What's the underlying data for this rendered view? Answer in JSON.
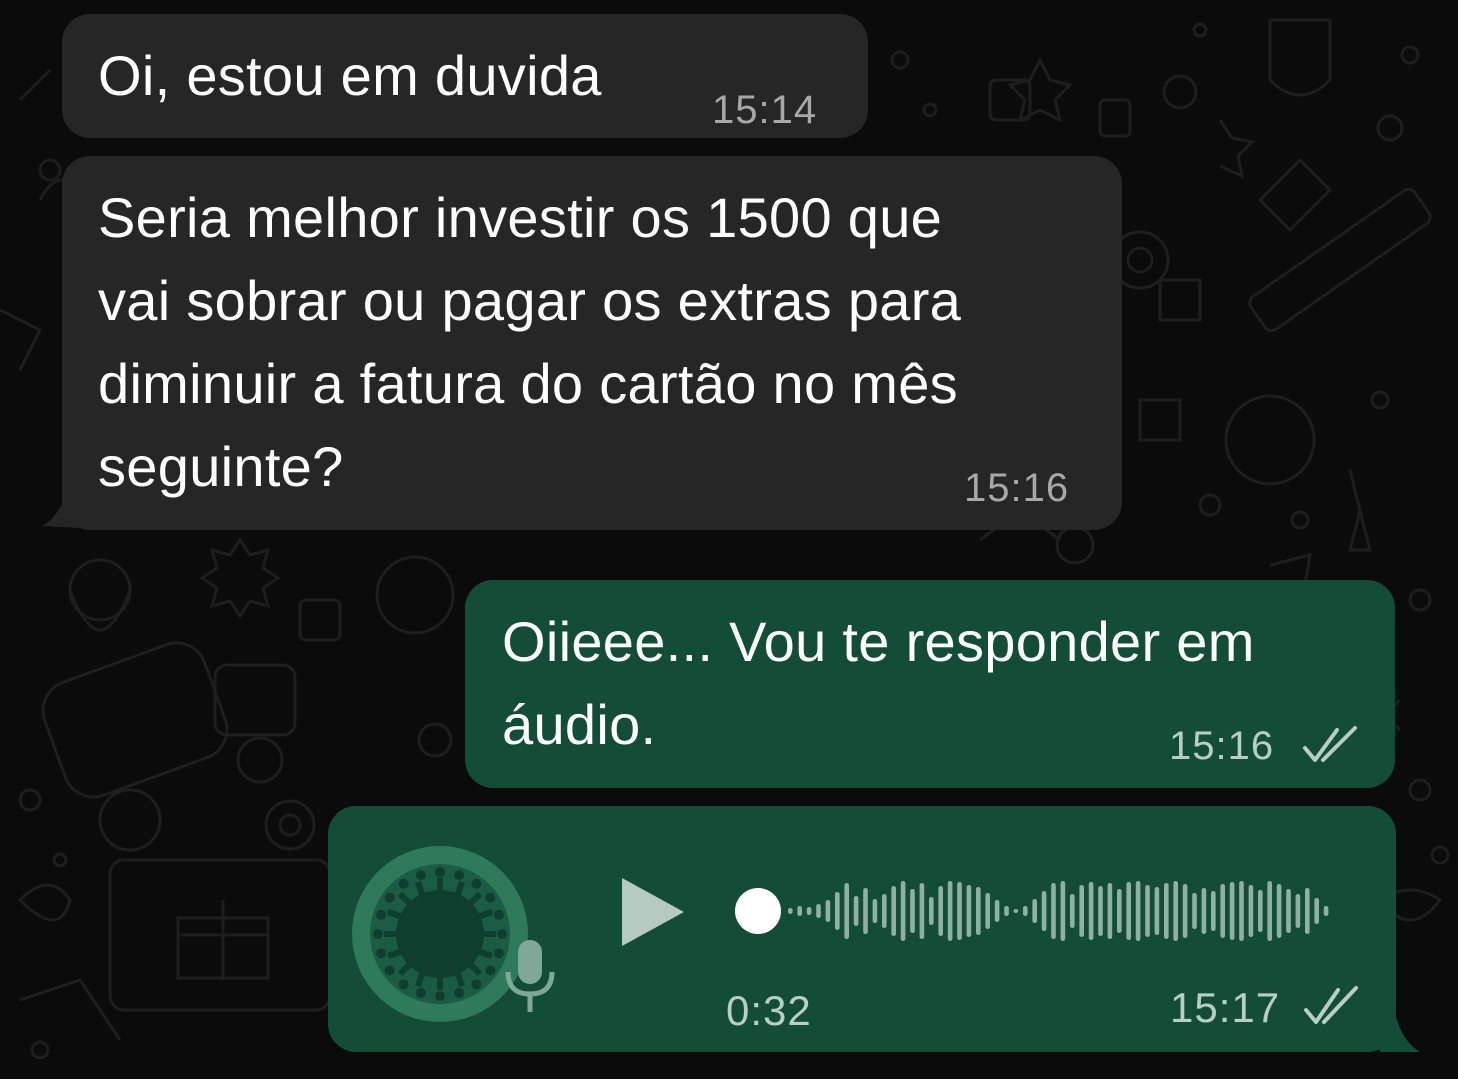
{
  "messages": [
    {
      "direction": "incoming",
      "text": "Oi, estou em duvida",
      "time": "15:14"
    },
    {
      "direction": "incoming",
      "text": "Seria melhor investir os 1500 que\nvai sobrar ou pagar os extras para\ndiminuir a fatura do cartão no mês\nseguinte?",
      "time": "15:16"
    },
    {
      "direction": "outgoing",
      "text": "Oiieee... Vou te responder em\náudio.",
      "time": "15:16",
      "status_icon": "double-check-icon"
    },
    {
      "direction": "outgoing",
      "type": "voice",
      "duration": "0:32",
      "time": "15:17",
      "status_icon": "double-check-icon",
      "playback_progress": 0
    }
  ],
  "colors": {
    "background": "#0b0b0b",
    "incoming_bubble": "#262626",
    "outgoing_bubble": "#144d37",
    "text": "#ffffff",
    "incoming_meta": "#a8a8a8",
    "outgoing_meta": "#b9cec5"
  },
  "icons": {
    "avatar": "avatar-icon",
    "mic": "microphone-icon",
    "play": "play-icon",
    "waveform": "waveform-icon"
  }
}
